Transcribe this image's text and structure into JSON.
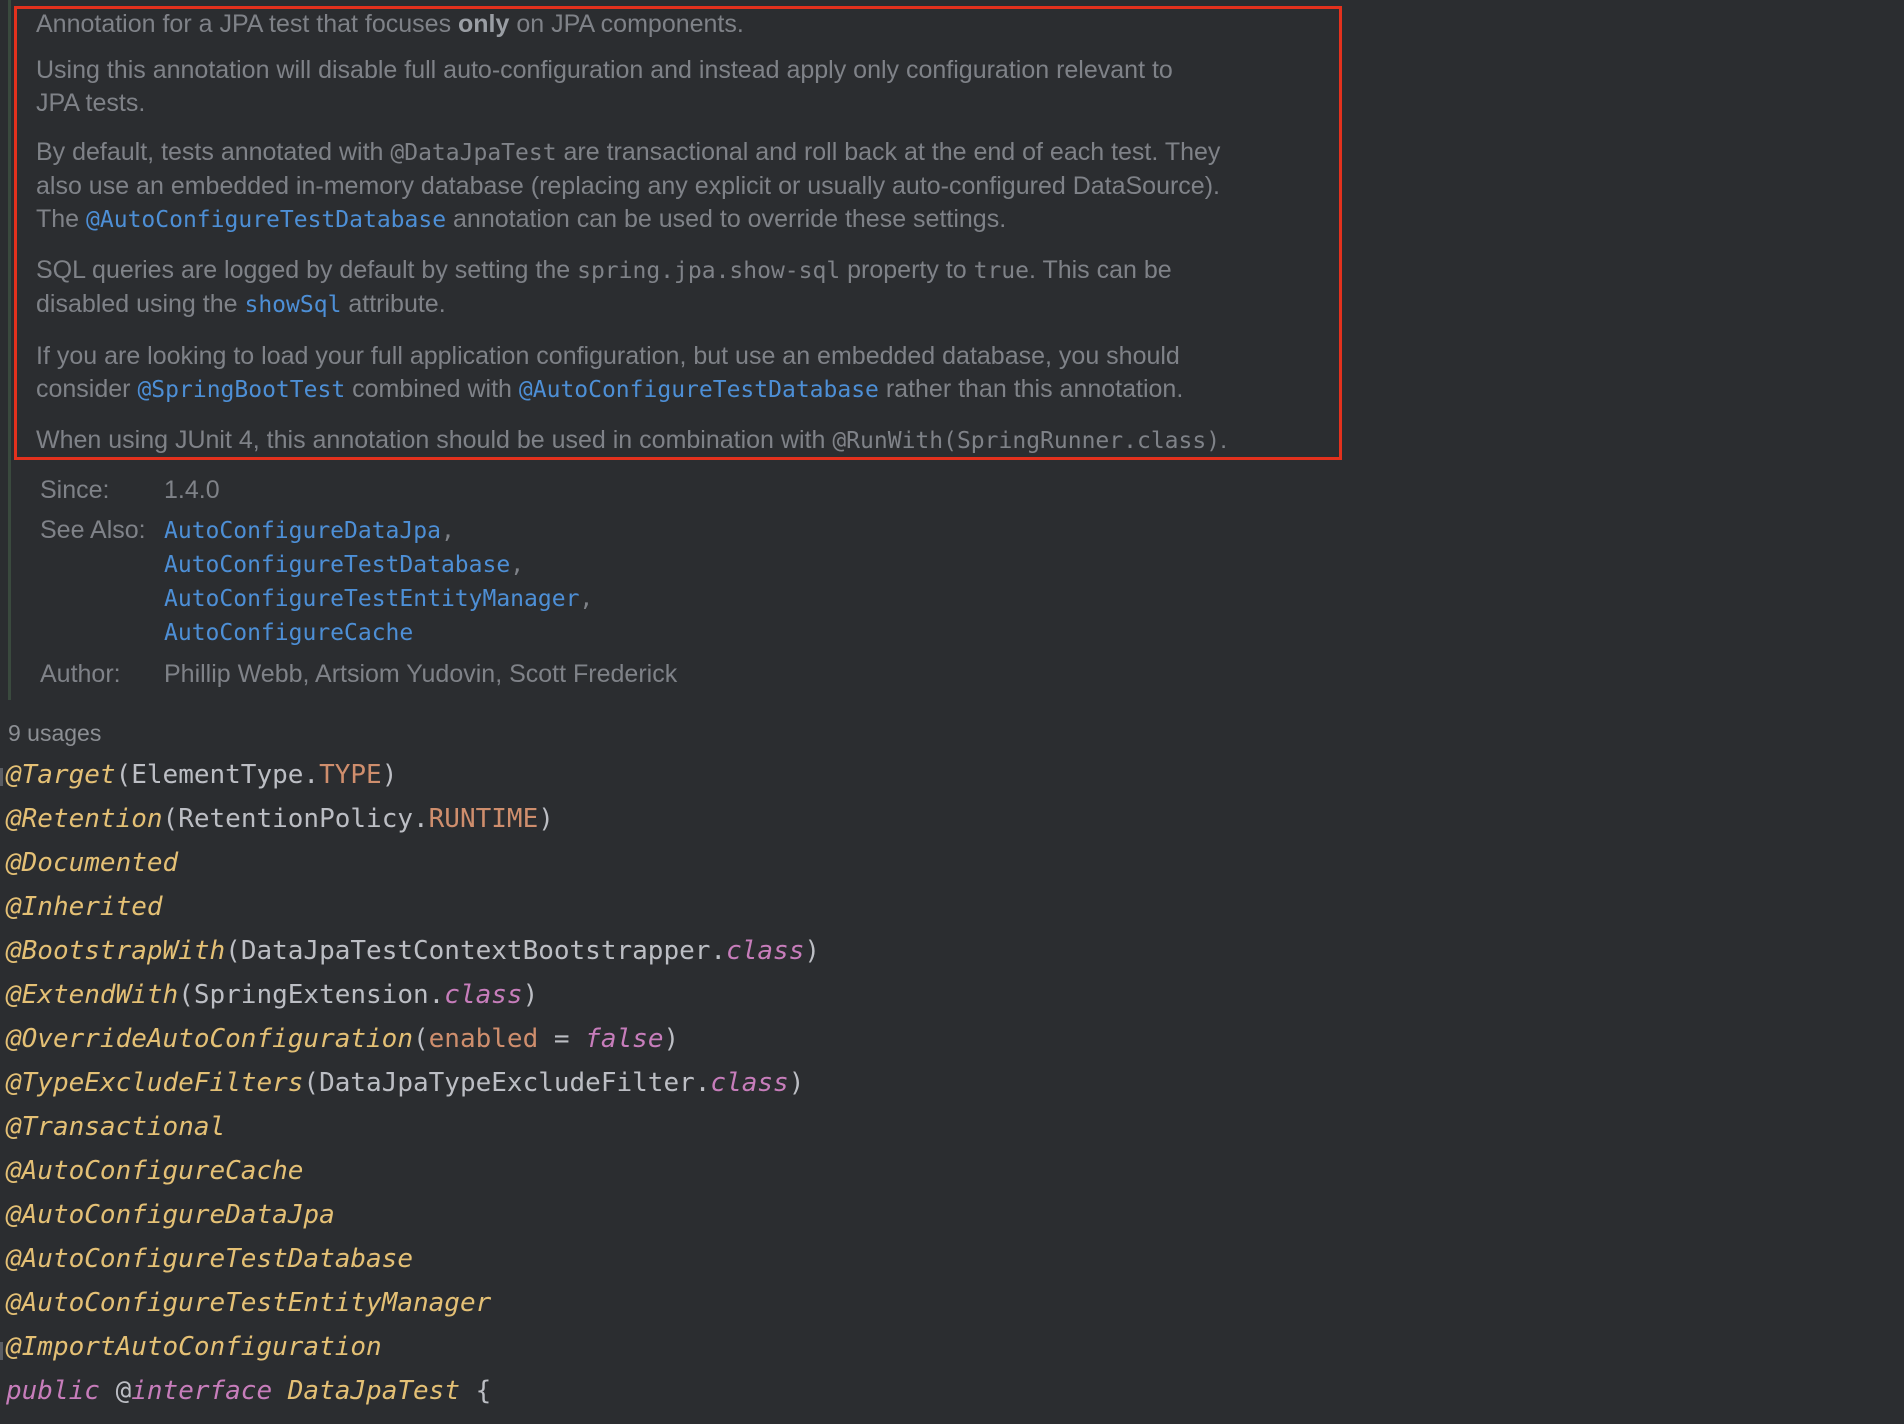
{
  "doc": {
    "p1": {
      "before": "Annotation for a JPA test that focuses ",
      "bold": "only",
      "after": " on JPA components."
    },
    "p2": {
      "line1": "Using this annotation will disable full auto-configuration and instead apply only configuration relevant to",
      "line2": "JPA tests."
    },
    "p3": {
      "a": "By default, tests annotated with ",
      "code1": "@DataJpaTest",
      "b": " are transactional and roll back at the end of each test. They",
      "line2": "also use an embedded in-memory database (replacing any explicit or usually auto-configured DataSource).",
      "c": "The ",
      "link1": "@AutoConfigureTestDatabase",
      "d": " annotation can be used to override these settings."
    },
    "p4": {
      "a": "SQL queries are logged by default by setting the ",
      "code1": "spring.jpa.show-sql",
      "b": " property to ",
      "code2": "true",
      "c": ". This can be",
      "d": "disabled using the ",
      "link1": "showSql",
      "e": " attribute."
    },
    "p5": {
      "line1": "If you are looking to load your full application configuration, but use an embedded database, you should",
      "a": "consider ",
      "link1": "@SpringBootTest",
      "b": " combined with ",
      "link2": "@AutoConfigureTestDatabase",
      "c": " rather than this annotation."
    },
    "p6": {
      "a": "When using JUnit 4, this annotation should be used in combination with ",
      "code1": "@RunWith(SpringRunner.class)",
      "b": "."
    },
    "since_label": "Since:",
    "since_value": "1.4.0",
    "see_also_label": "See Also:",
    "see_also": [
      "AutoConfigureDataJpa",
      "AutoConfigureTestDatabase",
      "AutoConfigureTestEntityManager",
      "AutoConfigureCache"
    ],
    "comma": ",",
    "author_label": "Author:",
    "author_value": "Phillip Webb, Artsiom Yudovin, Scott Frederick"
  },
  "usages": "9 usages",
  "code": {
    "l1": {
      "ann": "@Target",
      "open": "(",
      "cls": "ElementType.",
      "const": "TYPE",
      "close": ")"
    },
    "l2": {
      "ann": "@Retention",
      "open": "(",
      "cls": "RetentionPolicy.",
      "const": "RUNTIME",
      "close": ")"
    },
    "l3": {
      "ann": "@Documented"
    },
    "l4": {
      "ann": "@Inherited"
    },
    "l5": {
      "ann": "@BootstrapWith",
      "open": "(",
      "cls": "DataJpaTestContextBootstrapper.",
      "kw": "class",
      "close": ")"
    },
    "l6": {
      "ann": "@ExtendWith",
      "open": "(",
      "cls": "SpringExtension.",
      "kw": "class",
      "close": ")"
    },
    "l7": {
      "ann": "@OverrideAutoConfiguration",
      "open": "(",
      "param": "enabled",
      "eq": " = ",
      "kw": "false",
      "close": ")"
    },
    "l8": {
      "ann": "@TypeExcludeFilters",
      "open": "(",
      "cls": "DataJpaTypeExcludeFilter.",
      "kw": "class",
      "close": ")"
    },
    "l9": {
      "ann": "@Transactional"
    },
    "l10": {
      "ann": "@AutoConfigureCache"
    },
    "l11": {
      "ann": "@AutoConfigureDataJpa"
    },
    "l12": {
      "ann": "@AutoConfigureTestDatabase"
    },
    "l13": {
      "ann": "@AutoConfigureTestEntityManager"
    },
    "l14": {
      "ann": "@ImportAutoConfiguration"
    },
    "l15": {
      "kw1": "public",
      "at": " @",
      "kw2": "interface",
      "name": "DataJpaTest",
      "brace": " {"
    }
  }
}
